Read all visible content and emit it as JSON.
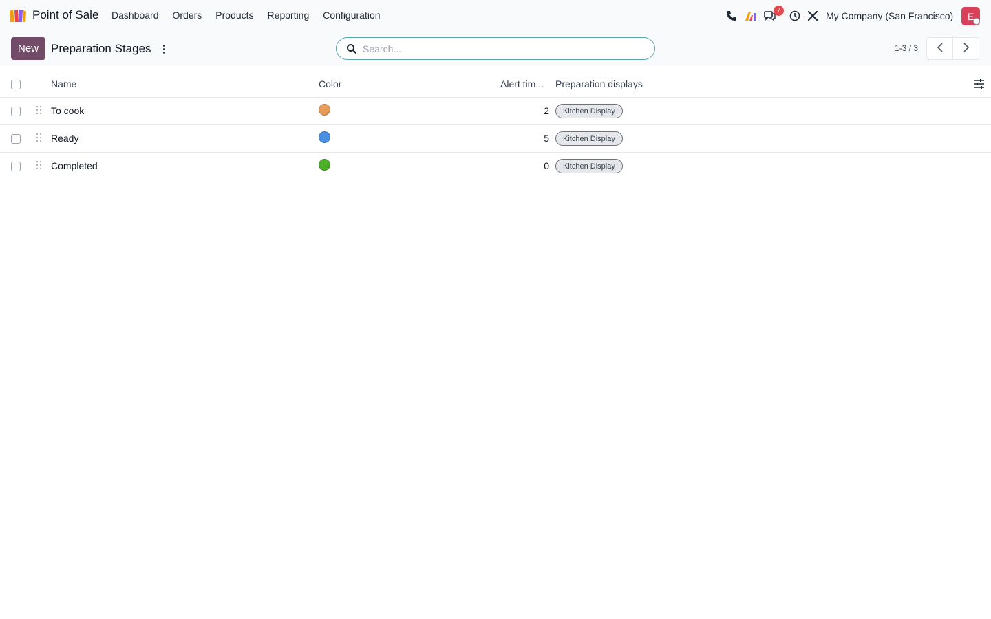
{
  "navbar": {
    "app_name": "Point of Sale",
    "menu": [
      "Dashboard",
      "Orders",
      "Products",
      "Reporting",
      "Configuration"
    ],
    "messages_badge": "7",
    "company": "My Company (San Francisco)",
    "avatar_initial": "E"
  },
  "control_panel": {
    "new_label": "New",
    "title": "Preparation Stages",
    "search_placeholder": "Search...",
    "pager_value": "1-3 / 3"
  },
  "list": {
    "columns": {
      "name": "Name",
      "color": "Color",
      "alert_time": "Alert tim...",
      "preparation_displays": "Preparation displays"
    },
    "rows": [
      {
        "name": "To cook",
        "color": "#e99d5a",
        "alert_time": "2",
        "display": "Kitchen Display"
      },
      {
        "name": "Ready",
        "color": "#4a90e2",
        "alert_time": "5",
        "display": "Kitchen Display"
      },
      {
        "name": "Completed",
        "color": "#4caf28",
        "alert_time": "0",
        "display": "Kitchen Display"
      }
    ]
  },
  "colors": {
    "primary": "#714b67",
    "avatar": "#d9415a",
    "badge": "#e5484d"
  }
}
